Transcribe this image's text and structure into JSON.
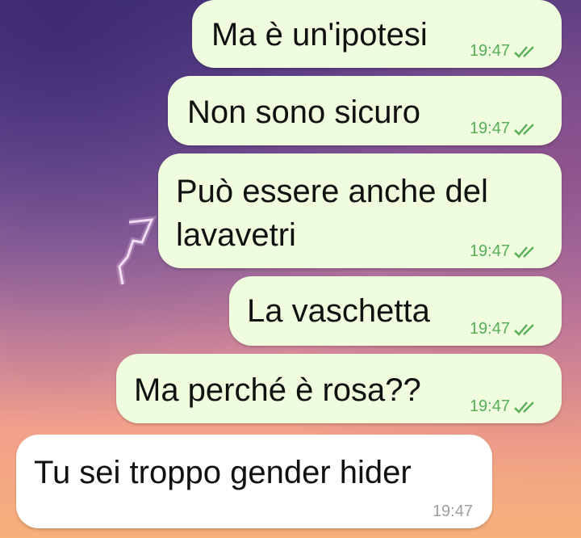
{
  "messages": [
    {
      "text": "Ma è un'ipotesi",
      "time": "19:47",
      "direction": "outgoing",
      "status_icon": "double-check-icon"
    },
    {
      "text": "Non sono sicuro",
      "time": "19:47",
      "direction": "outgoing",
      "status_icon": "double-check-icon"
    },
    {
      "text": "Può essere anche del\nlavavetri",
      "time": "19:47",
      "direction": "outgoing",
      "status_icon": "double-check-icon"
    },
    {
      "text": "La vaschetta",
      "time": "19:47",
      "direction": "outgoing",
      "status_icon": "double-check-icon"
    },
    {
      "text": "Ma perché è rosa??",
      "time": "19:47",
      "direction": "outgoing",
      "status_icon": "double-check-icon"
    },
    {
      "text": "Tu sei troppo gender hider",
      "time": "19:47",
      "direction": "incoming"
    }
  ],
  "colors": {
    "outgoing_bubble": "#effdde",
    "incoming_bubble": "#ffffff",
    "outgoing_meta": "#58b05a",
    "incoming_meta": "#9aa19a"
  }
}
